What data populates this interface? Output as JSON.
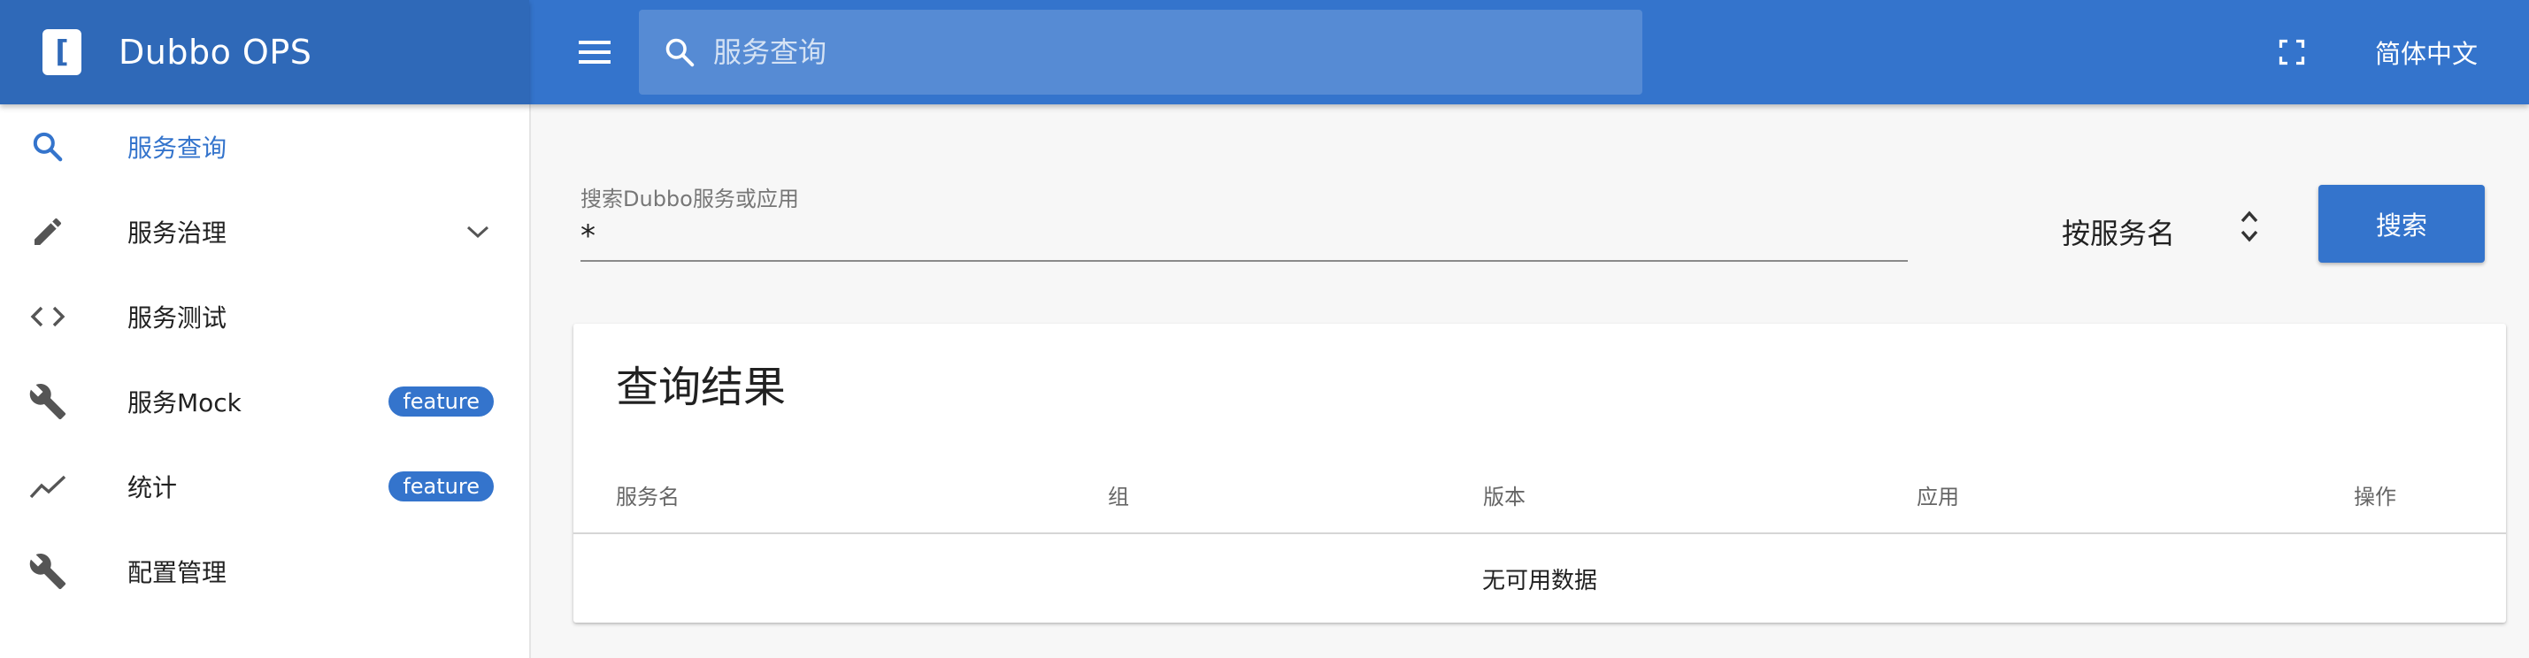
{
  "brand": {
    "logo_letter": "[",
    "title": "Dubbo OPS"
  },
  "topbar": {
    "search_placeholder": "服务查询",
    "language": "简体中文"
  },
  "sidebar": {
    "items": [
      {
        "label": "服务查询",
        "icon": "search-icon",
        "active": true
      },
      {
        "label": "服务治理",
        "icon": "pencil-icon",
        "expandable": true
      },
      {
        "label": "服务测试",
        "icon": "code-icon"
      },
      {
        "label": "服务Mock",
        "icon": "wrench-icon",
        "badge": "feature"
      },
      {
        "label": "统计",
        "icon": "trending-icon",
        "badge": "feature"
      },
      {
        "label": "配置管理",
        "icon": "wrench-icon"
      }
    ]
  },
  "search_form": {
    "label": "搜索Dubbo服务或应用",
    "value": "*",
    "filter_value": "按服务名",
    "button_label": "搜索"
  },
  "results": {
    "title": "查询结果",
    "columns": [
      "服务名",
      "组",
      "版本",
      "应用",
      "操作"
    ],
    "empty_text": "无可用数据"
  },
  "colors": {
    "brand_bar": "#2f69b8",
    "top_bar": "#3474cc",
    "accent": "#3474cc"
  }
}
